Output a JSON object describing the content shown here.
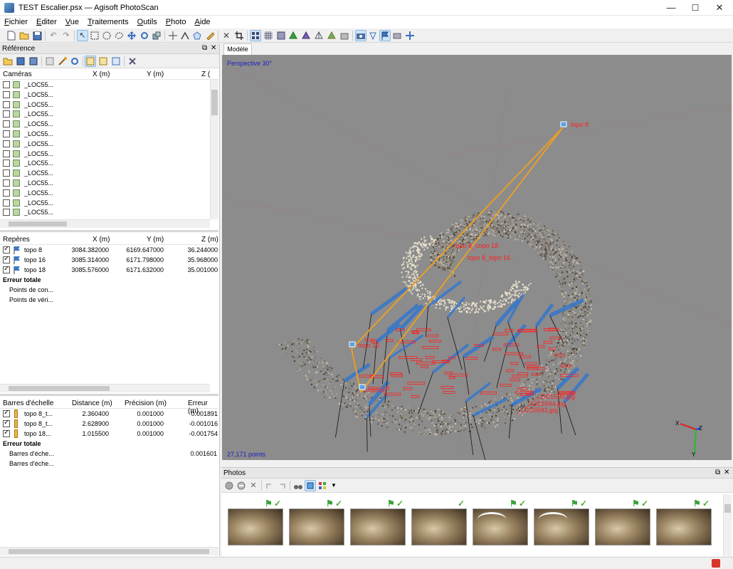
{
  "window": {
    "title": "TEST Escalier.psx — Agisoft PhotoScan",
    "minimize": "—",
    "maximize": "☐",
    "close": "✕"
  },
  "menu": [
    {
      "pre": "",
      "u": "F",
      "post": "ichier"
    },
    {
      "pre": "",
      "u": "E",
      "post": "diter"
    },
    {
      "pre": "",
      "u": "V",
      "post": "ue"
    },
    {
      "pre": "",
      "u": "T",
      "post": "raitements"
    },
    {
      "pre": "",
      "u": "O",
      "post": "utils"
    },
    {
      "pre": "",
      "u": "P",
      "post": "hoto"
    },
    {
      "pre": "",
      "u": "A",
      "post": "ide"
    }
  ],
  "reference": {
    "title": "Référence",
    "cameras_header": {
      "name": "Caméras",
      "x": "X (m)",
      "y": "Y (m)",
      "z": "Z ("
    },
    "cameras": [
      "_LOC55...",
      "_LOC55...",
      "_LOC55...",
      "_LOC55...",
      "_LOC55...",
      "_LOC55...",
      "_LOC55...",
      "_LOC55...",
      "_LOC55...",
      "_LOC55...",
      "_LOC55...",
      "_LOC55...",
      "_LOC55...",
      "_LOC55..."
    ],
    "markers_header": {
      "name": "Repères",
      "x": "X (m)",
      "y": "Y (m)",
      "z": "Z (m)"
    },
    "markers": [
      {
        "name": "topo 8",
        "x": "3084.382000",
        "y": "6169.647000",
        "z": "36.244000"
      },
      {
        "name": "topo 16",
        "x": "3085.314000",
        "y": "6171.798000",
        "z": "35.968000"
      },
      {
        "name": "topo 18",
        "x": "3085.576000",
        "y": "6171.632000",
        "z": "35.001000"
      }
    ],
    "markers_total": "Erreur totale",
    "markers_sub": [
      "Points de con...",
      "Points de véri..."
    ],
    "scalebars_header": {
      "name": "Barres d'échelle",
      "dist": "Distance (m)",
      "prec": "Précision (m)",
      "err": "Erreur (m)"
    },
    "scalebars": [
      {
        "name": "topo 8_t...",
        "dist": "2.360400",
        "prec": "0.001000",
        "err": "0.001891"
      },
      {
        "name": "topo 8_t...",
        "dist": "2.628900",
        "prec": "0.001000",
        "err": "-0.001016"
      },
      {
        "name": "topo 18...",
        "dist": "1.015500",
        "prec": "0.001000",
        "err": "-0.001754"
      }
    ],
    "scalebars_total": "Erreur totale",
    "scalebars_sub": [
      {
        "name": "Barres d'éche...",
        "err": "0.001601"
      },
      {
        "name": "Barres d'éche...",
        "err": ""
      }
    ]
  },
  "model": {
    "tab": "Modèle",
    "projection": "Perspective 30°",
    "points": "27,171 points",
    "labels": {
      "topo8": "topo 8",
      "topo8_18": "topo 8_copo 18",
      "topo8_16": "topo 8_topo 16",
      "topo16": "topo 16",
      "topo18": "topo 18",
      "img1": "_LOC5595.jpg",
      "img2": "_LOC5594.jpg",
      "img3": "_LOC5593.jpg"
    },
    "axes": {
      "x": "X",
      "y": "Y",
      "z": "Z"
    },
    "colors": {
      "background": "#8c8c8c",
      "marker_line": "#f0a020",
      "camera": "#3a78c8",
      "label": "#ff2020"
    }
  },
  "photos": {
    "title": "Photos",
    "count": 8
  },
  "icons": {
    "check": "✓",
    "flag": "⚑"
  }
}
